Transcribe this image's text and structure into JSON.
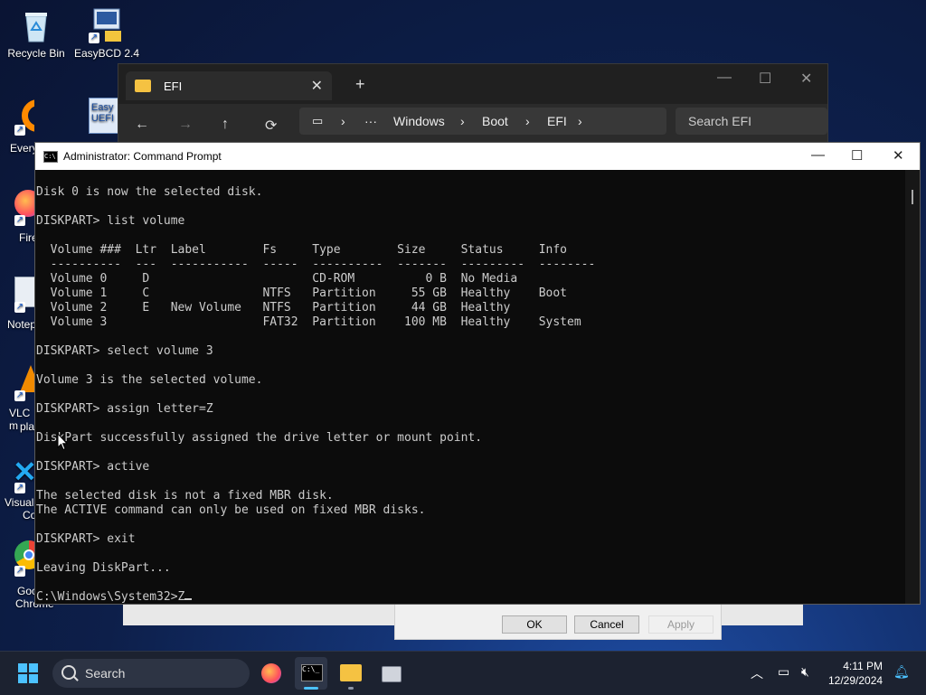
{
  "desktop": {
    "icons": [
      {
        "label": "Recycle Bin"
      },
      {
        "label": "EasyBCD 2.4"
      },
      {
        "label": "Every"
      },
      {
        "label": "Easy UEFI"
      },
      {
        "label": "Fire"
      },
      {
        "label": "Notep"
      },
      {
        "label": "VLC m"
      },
      {
        "label": "pla"
      },
      {
        "label": "Visual"
      },
      {
        "label": "Co"
      },
      {
        "label": "Goo"
      },
      {
        "label": "Chrome"
      }
    ]
  },
  "explorer": {
    "tab_title": "EFI",
    "close_tab": "✕",
    "new_tab": "+",
    "breadcrumb": [
      "Windows",
      "Boot",
      "EFI"
    ],
    "more": "···",
    "search_placeholder": "Search EFI"
  },
  "dialog": {
    "ok_label": "OK",
    "cancel_label": "Cancel",
    "apply_label": "Apply"
  },
  "cmd": {
    "title": "Administrator: Command Prompt",
    "lines": [
      "Disk 0 is now the selected disk.",
      "",
      "DISKPART> list volume",
      "",
      "  Volume ###  Ltr  Label        Fs     Type        Size     Status     Info",
      "  ----------  ---  -----------  -----  ----------  -------  ---------  --------",
      "  Volume 0     D                       CD-ROM          0 B  No Media",
      "  Volume 1     C                NTFS   Partition     55 GB  Healthy    Boot",
      "  Volume 2     E   New Volume   NTFS   Partition     44 GB  Healthy",
      "  Volume 3                      FAT32  Partition    100 MB  Healthy    System",
      "",
      "DISKPART> select volume 3",
      "",
      "Volume 3 is the selected volume.",
      "",
      "DISKPART> assign letter=Z",
      "",
      "DiskPart successfully assigned the drive letter or mount point.",
      "",
      "DISKPART> active",
      "",
      "The selected disk is not a fixed MBR disk.",
      "The ACTIVE command can only be used on fixed MBR disks.",
      "",
      "DISKPART> exit",
      "",
      "Leaving DiskPart...",
      "",
      "C:\\Windows\\System32>Z"
    ]
  },
  "taskbar": {
    "search_label": "Search",
    "time": "4:11 PM",
    "date": "12/29/2024"
  },
  "colors": {
    "console_bg": "#0c0c0c",
    "console_fg": "#cccccc",
    "accent": "#4cc2ff",
    "taskbar_bg": "#1c2230"
  }
}
